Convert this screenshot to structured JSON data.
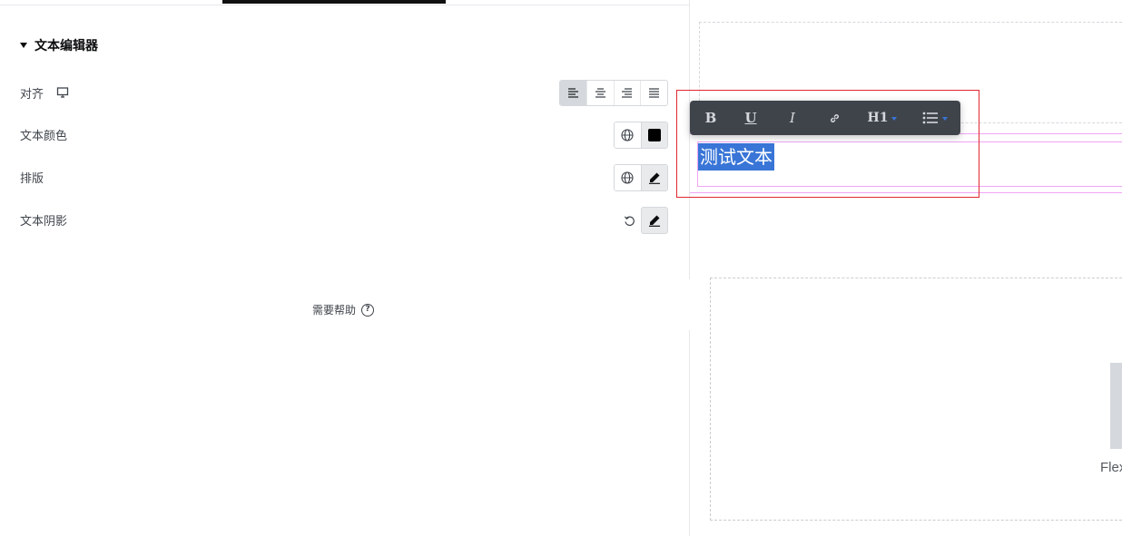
{
  "panel": {
    "section": {
      "title": "文本编辑器"
    },
    "rows": {
      "align": {
        "label": "对齐",
        "options": [
          "left",
          "center",
          "right",
          "justify"
        ],
        "selected": "left"
      },
      "text_color": {
        "label": "文本颜色",
        "value": "#000000"
      },
      "typography": {
        "label": "排版"
      },
      "text_shadow": {
        "label": "文本阴影"
      }
    },
    "help": {
      "label": "需要帮助",
      "icon": "?"
    }
  },
  "canvas": {
    "selected_text": "测试文本",
    "partial_label": "Flex"
  },
  "toolbar": {
    "bold": "B",
    "underline": "U",
    "italic": "I",
    "heading": "H1"
  },
  "colors": {
    "accent_blue": "#3875d7",
    "highlight_red": "#e0262f",
    "widget_outline": "#f0a5f5",
    "toolbar_bg": "#3f444b"
  }
}
